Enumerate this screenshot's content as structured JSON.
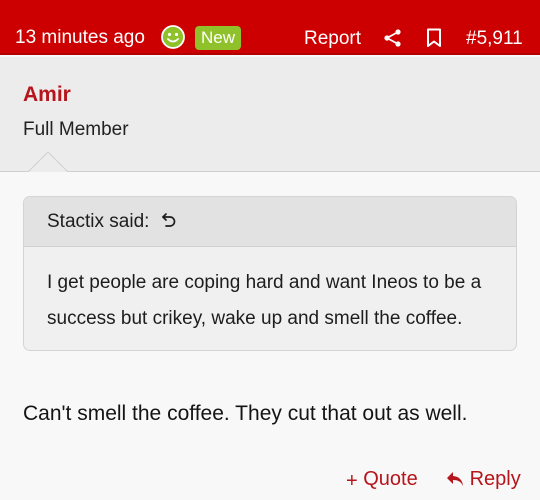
{
  "post_header": {
    "time": "13 minutes ago",
    "new_badge": "New",
    "report": "Report",
    "post_number": "#5,911",
    "accent_color": "#cc0000",
    "badge_color": "#8fc12b"
  },
  "author": {
    "name": "Amir",
    "title": "Full Member"
  },
  "quote": {
    "attribution": "Stactix said:",
    "text": "I get people are coping hard and want Ineos to be a success but crikey, wake up and smell the coffee."
  },
  "message": {
    "text": "Can't smell the coffee. They cut that out as well."
  },
  "actions": {
    "quote_label": "Quote",
    "reply_label": "Reply",
    "quote_prefix": "+"
  }
}
